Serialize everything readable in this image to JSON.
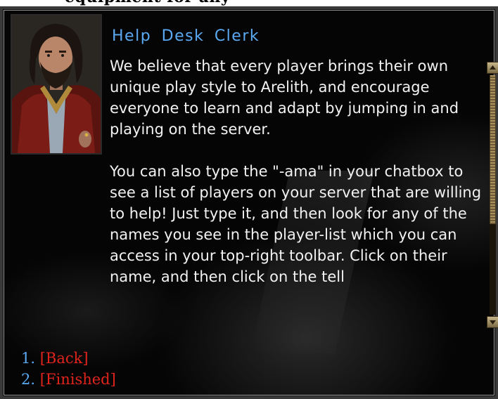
{
  "top_strip_text": "equipment for any",
  "dialog": {
    "speaker_name": "Help Desk Clerk",
    "text": "We believe that every player brings their own unique play style to Arelith, and encourage everyone to learn and adapt by jumping in and playing on the server.\n\nYou can also type the \"-ama\" in your chatbox to see a list of players on your server that are willing to help! Just type it, and then look for any of the names you see in the player-list which you can access in your top-right toolbar. Click on their name, and then click on the tell"
  },
  "replies": [
    {
      "number": "1.",
      "label": "[Back]"
    },
    {
      "number": "2.",
      "label": "[Finished]"
    }
  ],
  "scroll_position_fraction": 0.0,
  "colors": {
    "speaker": "#5aa9f2",
    "reply_number": "#5aa9f2",
    "reply_text": "#e0241c",
    "body_text": "#f2f2f2",
    "background": "#050505"
  }
}
